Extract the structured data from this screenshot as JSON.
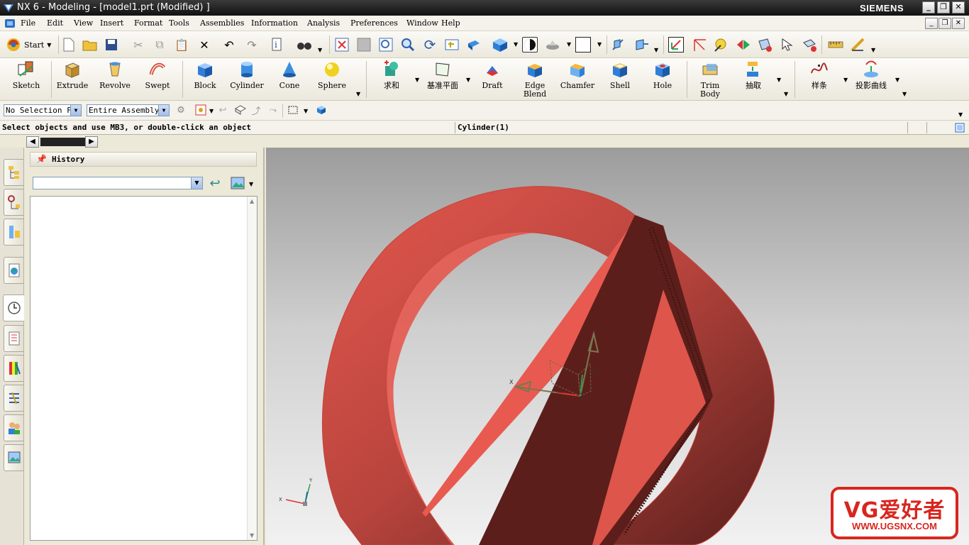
{
  "window": {
    "title": "NX 6 - Modeling - [model1.prt (Modified) ]",
    "brand": "SIEMENS",
    "controls": [
      "_",
      "❐",
      "✕"
    ]
  },
  "menu": {
    "items": [
      "File",
      "Edit",
      "View",
      "Insert",
      "Format",
      "Tools",
      "Assemblies",
      "Information",
      "Analysis",
      "Preferences",
      "Window",
      "Help"
    ]
  },
  "standard_toolbar": {
    "start_label": "Start"
  },
  "feature_toolbar": {
    "items": [
      {
        "label": "Sketch",
        "icon": "sketch-icon"
      },
      {
        "label": "Extrude",
        "icon": "extrude-icon"
      },
      {
        "label": "Revolve",
        "icon": "revolve-icon"
      },
      {
        "label": "Swept",
        "icon": "swept-icon"
      },
      {
        "label": "Block",
        "icon": "block-icon"
      },
      {
        "label": "Cylinder",
        "icon": "cylinder-icon"
      },
      {
        "label": "Cone",
        "icon": "cone-icon"
      },
      {
        "label": "Sphere",
        "icon": "sphere-icon"
      },
      {
        "label": "求和",
        "icon": "unite-icon"
      },
      {
        "label": "基准平面",
        "icon": "datum-plane-icon"
      },
      {
        "label": "Draft",
        "icon": "draft-icon"
      },
      {
        "label": "Edge\nBlend",
        "icon": "edge-blend-icon"
      },
      {
        "label": "Chamfer",
        "icon": "chamfer-icon"
      },
      {
        "label": "Shell",
        "icon": "shell-icon"
      },
      {
        "label": "Hole",
        "icon": "hole-icon"
      },
      {
        "label": "Trim\nBody",
        "icon": "trim-body-icon"
      },
      {
        "label": "抽取",
        "icon": "extract-icon"
      },
      {
        "label": "样条",
        "icon": "spline-icon"
      },
      {
        "label": "投影曲线",
        "icon": "project-curve-icon"
      }
    ]
  },
  "selection_bar": {
    "filter": "No Selection Filter",
    "scope": "Entire Assembly"
  },
  "status": {
    "prompt": "Select objects and use MB3, or double-click an object",
    "message": "Cylinder(1)"
  },
  "history_panel": {
    "title": "History",
    "combo_value": ""
  },
  "viewport": {
    "wcs_labels": {
      "x": "X",
      "y": "Y",
      "xc": "XC",
      "yc": "YC"
    },
    "triad_labels": {
      "x": "X",
      "y": "Y"
    }
  },
  "watermark": {
    "title": "VG爱好者",
    "url": "WWW.UGSNX.COM"
  },
  "colors": {
    "model_light": "#e4584e",
    "model_dark": "#5a1f1c",
    "watermark_red": "#d8261e"
  }
}
